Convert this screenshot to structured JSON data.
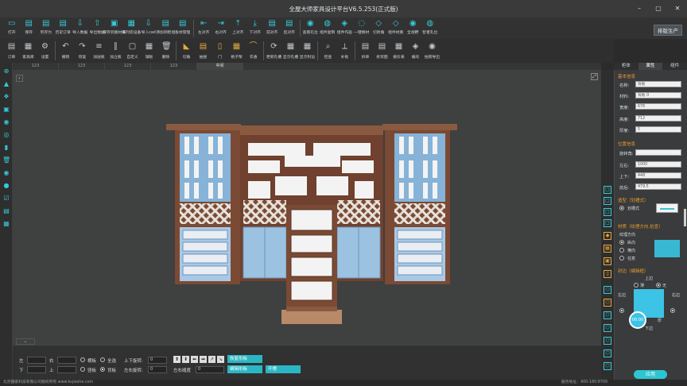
{
  "window": {
    "title": "全屋大师家具设计平台V6.5.253(正式版)",
    "controls": [
      "–",
      "▢",
      "✕"
    ]
  },
  "toolbar1": {
    "items": [
      {
        "label": "打开",
        "icon": "folder-open-icon"
      },
      {
        "label": "保存",
        "icon": "save-icon"
      },
      {
        "label": "另存为",
        "icon": "save-as-icon"
      },
      {
        "label": "历史订单",
        "icon": "history-icon"
      },
      {
        "label": "导入数据",
        "icon": "import-icon"
      },
      {
        "label": "导出数据",
        "icon": "export-icon"
      },
      {
        "label": "保存到素材库",
        "icon": "save-library-icon"
      },
      {
        "label": "排列房设备",
        "icon": "arrange-icon"
      },
      {
        "label": "导入cad",
        "icon": "import-cad-icon"
      },
      {
        "label": "添加到柜组",
        "icon": "add-group-icon"
      },
      {
        "label": "板材管理",
        "icon": "board-manage-icon"
      },
      {
        "label": "左对齐",
        "icon": "align-left-icon"
      },
      {
        "label": "右对齐",
        "icon": "align-right-icon"
      },
      {
        "label": "上对齐",
        "icon": "align-top-icon"
      },
      {
        "label": "下对齐",
        "icon": "align-bottom-icon"
      },
      {
        "label": "前对齐",
        "icon": "align-front-icon"
      },
      {
        "label": "后对齐",
        "icon": "align-back-icon"
      },
      {
        "label": "查看孔位",
        "icon": "view-holes-icon"
      },
      {
        "label": "组件复制",
        "icon": "component-copy-icon"
      },
      {
        "label": "组件作画",
        "icon": "component-draw-icon"
      },
      {
        "label": "一键换材",
        "icon": "one-key-material-icon"
      },
      {
        "label": "切封角",
        "icon": "cut-edge-icon"
      },
      {
        "label": "组件材质",
        "icon": "component-material-icon"
      },
      {
        "label": "全视野",
        "icon": "full-view-icon"
      },
      {
        "label": "智者孔位",
        "icon": "smart-holes-icon"
      }
    ],
    "produce_label": "排版生产"
  },
  "toolbar2": {
    "items": [
      {
        "label": "订单",
        "icon": "order-icon"
      },
      {
        "label": "家具库",
        "icon": "furniture-library-icon"
      },
      {
        "label": "设置",
        "icon": "settings-icon"
      },
      {
        "label": "撤销",
        "icon": "undo-icon"
      },
      {
        "label": "恢复",
        "icon": "redo-icon"
      },
      {
        "label": "加层板",
        "icon": "add-shelf-icon"
      },
      {
        "label": "加立板",
        "icon": "add-vertical-icon"
      },
      {
        "label": "自定义",
        "icon": "custom-icon"
      },
      {
        "label": "辅板",
        "icon": "aux-board-icon"
      },
      {
        "label": "删除",
        "icon": "delete-icon"
      },
      {
        "label": "切角",
        "icon": "chamfer-icon"
      },
      {
        "label": "抽屉",
        "icon": "drawer-icon"
      },
      {
        "label": "门",
        "icon": "door-icon"
      },
      {
        "label": "格子架",
        "icon": "grid-rack-icon"
      },
      {
        "label": "衣通",
        "icon": "hanger-rod-icon"
      },
      {
        "label": "更新孔槽",
        "icon": "refresh-holes-icon"
      },
      {
        "label": "显示孔槽",
        "icon": "show-holes-icon"
      },
      {
        "label": "显示封边",
        "icon": "show-edge-icon"
      },
      {
        "label": "检查",
        "icon": "check-icon"
      },
      {
        "label": "补板",
        "icon": "patch-board-icon"
      },
      {
        "label": "拆单",
        "icon": "split-order-icon"
      },
      {
        "label": "拆装图",
        "icon": "assembly-icon"
      },
      {
        "label": "报价表",
        "icon": "quote-icon"
      },
      {
        "label": "编号",
        "icon": "number-tag-icon"
      },
      {
        "label": "拍照导出",
        "icon": "camera-icon"
      }
    ]
  },
  "doc_tabs": [
    "123",
    "123",
    "123",
    "123",
    "中间"
  ],
  "panel_tabs": [
    "柜体",
    "属性",
    "组件"
  ],
  "properties": {
    "basic_title": "基本信息",
    "name_label": "名称:",
    "name_value": "背板",
    "material_label": "材料:",
    "material_value": "背板 0",
    "width_label": "宽度:",
    "width_value": "676",
    "height_label": "高度:",
    "height_value": "712",
    "thickness_label": "厚度:",
    "thickness_value": "5",
    "pos_title": "位置信息",
    "rotation_label": "旋转角:",
    "lr_label": "左右:",
    "lr_value": "1000",
    "ud_label": "上下:",
    "ud_value": "448",
    "fb_label": "前后:",
    "fb_value": "479.5",
    "shape_title": "造型（划槽式）",
    "shape_option": "划槽式",
    "grain_title": "材质（纹理方向,检查）",
    "grain_label": "纹理方向",
    "grain_options": [
      "纵向",
      "横向",
      "任意"
    ],
    "edge_title": "封边（编辑框）",
    "edge_top": "上边",
    "edge_left": "左边",
    "edge_right": "右边",
    "edge_bottom": "下边",
    "edge_choices": [
      "薄",
      "厚",
      "无"
    ],
    "edge_center": "00.00",
    "apply_label": "应用"
  },
  "bottom": {
    "left_label": "左",
    "right_label": "右",
    "down_label": "下",
    "up_label": "上",
    "horizontal": "横板",
    "all_select": "全选",
    "vertical": "竖板",
    "back": "背板",
    "ud_rotate": "上下旋转:",
    "lr_rotate": "左右旋转:",
    "ud_value": "0",
    "lr_value": "0",
    "lr_gap": "左右缝度",
    "lr_gap_value": "0",
    "restore": "恢复形板",
    "edit": "编辑形板",
    "open": "开槽",
    "arrows": [
      "⬆",
      "⬇",
      "⬅",
      "➡",
      "↗",
      "↘"
    ]
  },
  "status": {
    "left": "北京酷家科技有限公司版权所有 www.kujiashe.com",
    "right": "服务地址：400-180-8700"
  },
  "colors": {
    "accent": "#37c9d7",
    "orange": "#e69a2e",
    "wood": "#7a4a34"
  }
}
